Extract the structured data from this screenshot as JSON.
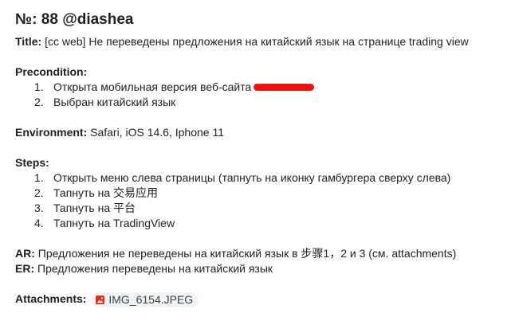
{
  "ticket": {
    "heading": "№: 88 @diashea",
    "title_label": "Title:",
    "title_text": "[cc web] Не переведены предложения на китайский язык на странице trading view"
  },
  "precondition": {
    "label": "Precondition:",
    "items": [
      {
        "num": "1.",
        "text": "Открыта мобильная версия веб-сайта"
      },
      {
        "num": "2.",
        "text": "Выбран китайский язык"
      }
    ]
  },
  "environment": {
    "label": "Environment:",
    "text": "Safari, iOS 14.6, Iphone 11"
  },
  "steps": {
    "label": "Steps:",
    "items": [
      {
        "num": "1.",
        "text": "Открыть меню слева страницы (тапнуть на иконку гамбургера сверху слева)"
      },
      {
        "num": "2.",
        "text": "Тапнуть на 交易应用"
      },
      {
        "num": "3.",
        "text": "Тапнуть на 平台"
      },
      {
        "num": "4.",
        "text": "Тапнуть на TradingView"
      }
    ]
  },
  "ar": {
    "label": "AR:",
    "text": "Предложения не переведены на китайский язык в 步骤1，2 и 3 (см. attachments)"
  },
  "er": {
    "label": "ER:",
    "text": "Предложения переведены на китайский язык"
  },
  "attachments": {
    "label": "Attachments:",
    "file_name": "IMG_6154.JPEG",
    "icon": "image-file-icon",
    "icon_color": "#d93025"
  },
  "colors": {
    "redaction": "#ff0a0a",
    "chip_background": "#f1f3f4"
  }
}
